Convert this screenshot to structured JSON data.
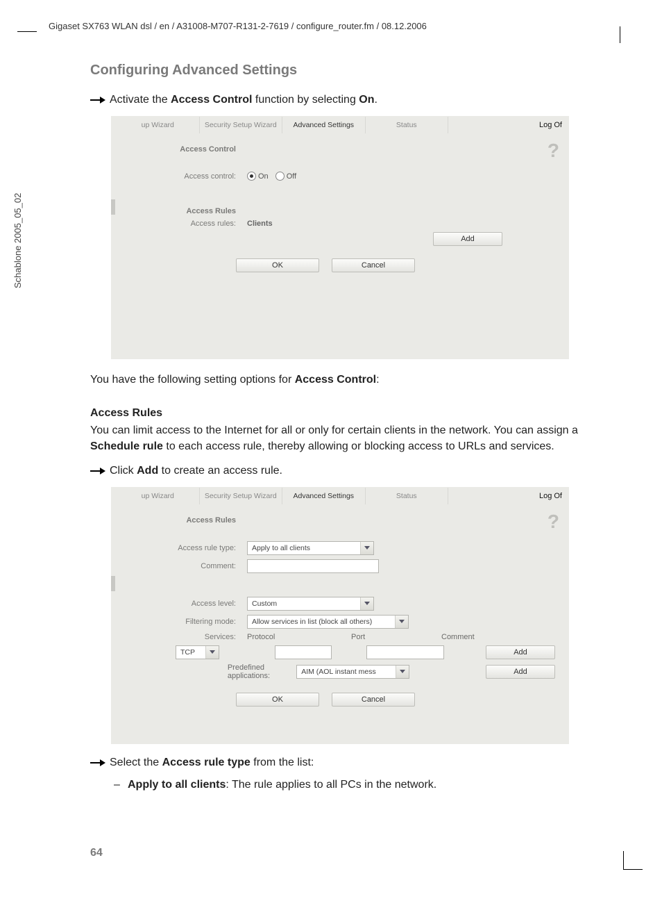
{
  "page": {
    "header_path": "Gigaset SX763 WLAN dsl / en / A31008-M707-R131-2-7619 / configure_router.fm / 08.12.2006",
    "side_label": "Schablone 2005_05_02",
    "number": "64"
  },
  "doc": {
    "heading": "Configuring Advanced Settings",
    "instr1_pre": "Activate the ",
    "instr1_b1": "Access Control",
    "instr1_mid": " function by selecting ",
    "instr1_b2": "On",
    "instr1_post": ".",
    "para1_pre": "You have the following setting options for ",
    "para1_b": "Access Control",
    "para1_post": ":",
    "sub1": "Access Rules",
    "para2_pre": "You can limit access to the Internet for all or only for certain clients in the network. You can assign a ",
    "para2_b": "Schedule rule",
    "para2_post": " to each access rule, thereby allowing or blocking access to URLs and services.",
    "instr2_pre": "Click ",
    "instr2_b": "Add",
    "instr2_post": " to create an access rule.",
    "instr3_pre": "Select the ",
    "instr3_b": "Access rule type",
    "instr3_post": " from the list:",
    "bullet1_b": "Apply to all clients",
    "bullet1_post": ": The rule applies to all PCs in the network."
  },
  "ui": {
    "tabs": {
      "t1": "up Wizard",
      "t2": "Security Setup Wizard",
      "t3": "Advanced Settings",
      "t4": "Status"
    },
    "logoff": "Log Of",
    "help": "?",
    "btn_ok": "OK",
    "btn_cancel": "Cancel",
    "btn_add": "Add"
  },
  "shot1": {
    "title1": "Access Control",
    "lbl_ac": "Access control:",
    "on": "On",
    "off": "Off",
    "title2": "Access Rules",
    "lbl_rules": "Access rules:",
    "clients": "Clients"
  },
  "shot2": {
    "title": "Access Rules",
    "lbl_type": "Access rule type:",
    "sel_type": "Apply to all clients",
    "lbl_comment": "Comment:",
    "lbl_level": "Access level:",
    "sel_level": "Custom",
    "lbl_filter": "Filtering mode:",
    "sel_filter": "Allow services in list (block all others)",
    "lbl_services": "Services:",
    "col_proto": "Protocol",
    "col_port": "Port",
    "col_comment": "Comment",
    "sel_proto": "TCP",
    "lbl_predef": "Predefined applications:",
    "sel_predef": "AIM (AOL instant mess"
  }
}
